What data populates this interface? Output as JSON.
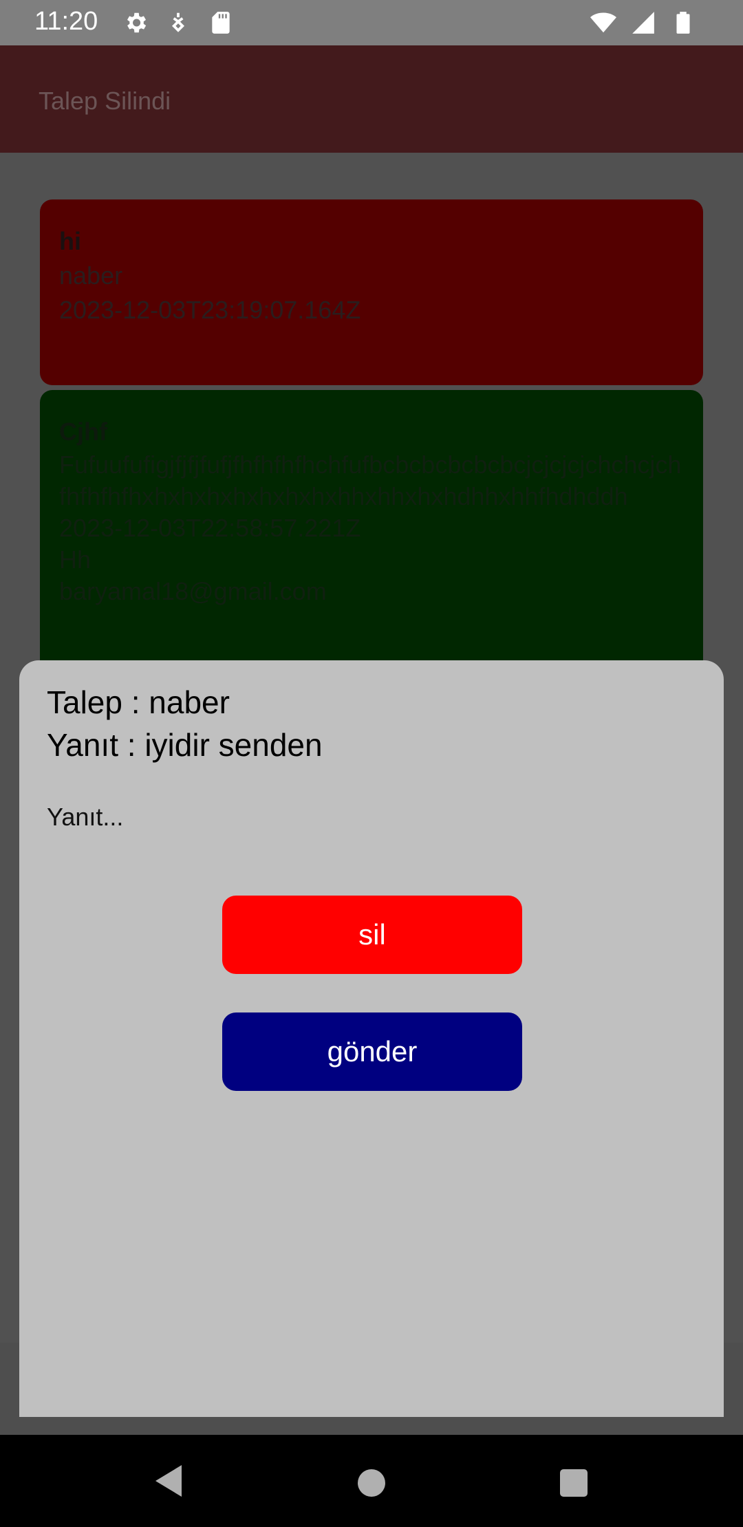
{
  "status_bar": {
    "time": "11:20",
    "icons_left": [
      "gear-icon",
      "usb-debug-icon",
      "sd-card-icon"
    ],
    "icons_right": [
      "wifi-icon",
      "signal-icon",
      "battery-icon"
    ]
  },
  "app_bar": {
    "title": "Talep Silindi"
  },
  "cards": [
    {
      "title": "hi",
      "body": "naber",
      "timestamp": "2023-12-03T23:19:07.164Z",
      "color": "#540000"
    },
    {
      "title": "Cjhf",
      "body": "Fufuufufigjfjfjfufjfhfhfhfhchfufbcbcbcbcbcbcjcjcjcjchchcjchfhfhfhfhxhxhxhxhxhxhxhxhhxhhxhxhdhhxhhfhdhddh",
      "timestamp": "2023-12-03T22:58:57.221Z",
      "extra": "Hh",
      "email": "baryamal18@gmail.com",
      "color": "#012701"
    }
  ],
  "dialog": {
    "request_text": "Talep : naber",
    "answer_text": "Yanıt : iyidir senden",
    "input_placeholder": "Yanıt...",
    "delete_label": "sil",
    "send_label": "gönder",
    "delete_color": "#ff0000",
    "send_color": "#000080"
  },
  "nav_bar": {
    "icons": [
      "back-icon",
      "home-icon",
      "recents-icon"
    ]
  }
}
